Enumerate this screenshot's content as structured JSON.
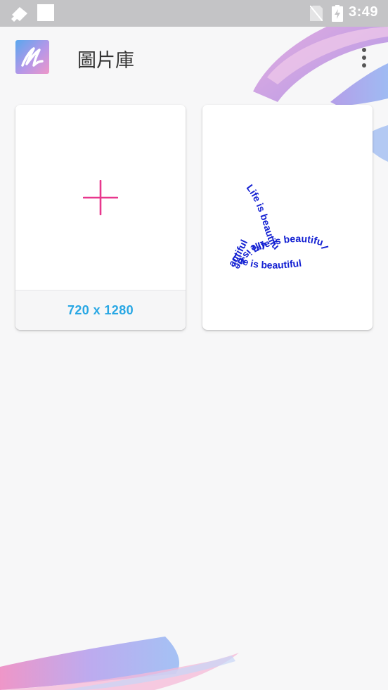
{
  "status_bar": {
    "time": "3:49",
    "icons": [
      "brush-notification-icon",
      "square-notification-icon",
      "no-sim-icon",
      "battery-charging-icon"
    ]
  },
  "app_bar": {
    "title": "圖片庫",
    "logo_icon": "app-logo-icon",
    "menu_icon": "more-vert-icon"
  },
  "cards": {
    "new_canvas": {
      "icon": "plus-icon",
      "size_label": "720 x 1280"
    },
    "saved_drawing": {
      "thumbnail_text": "Life is beautiful"
    }
  },
  "colors": {
    "accent_blue": "#28a7e4",
    "plus_pink": "#e8378d",
    "thumbnail_text": "#1320d2",
    "status_bar": "#c4c4c6",
    "background": "#f7f7f8"
  }
}
